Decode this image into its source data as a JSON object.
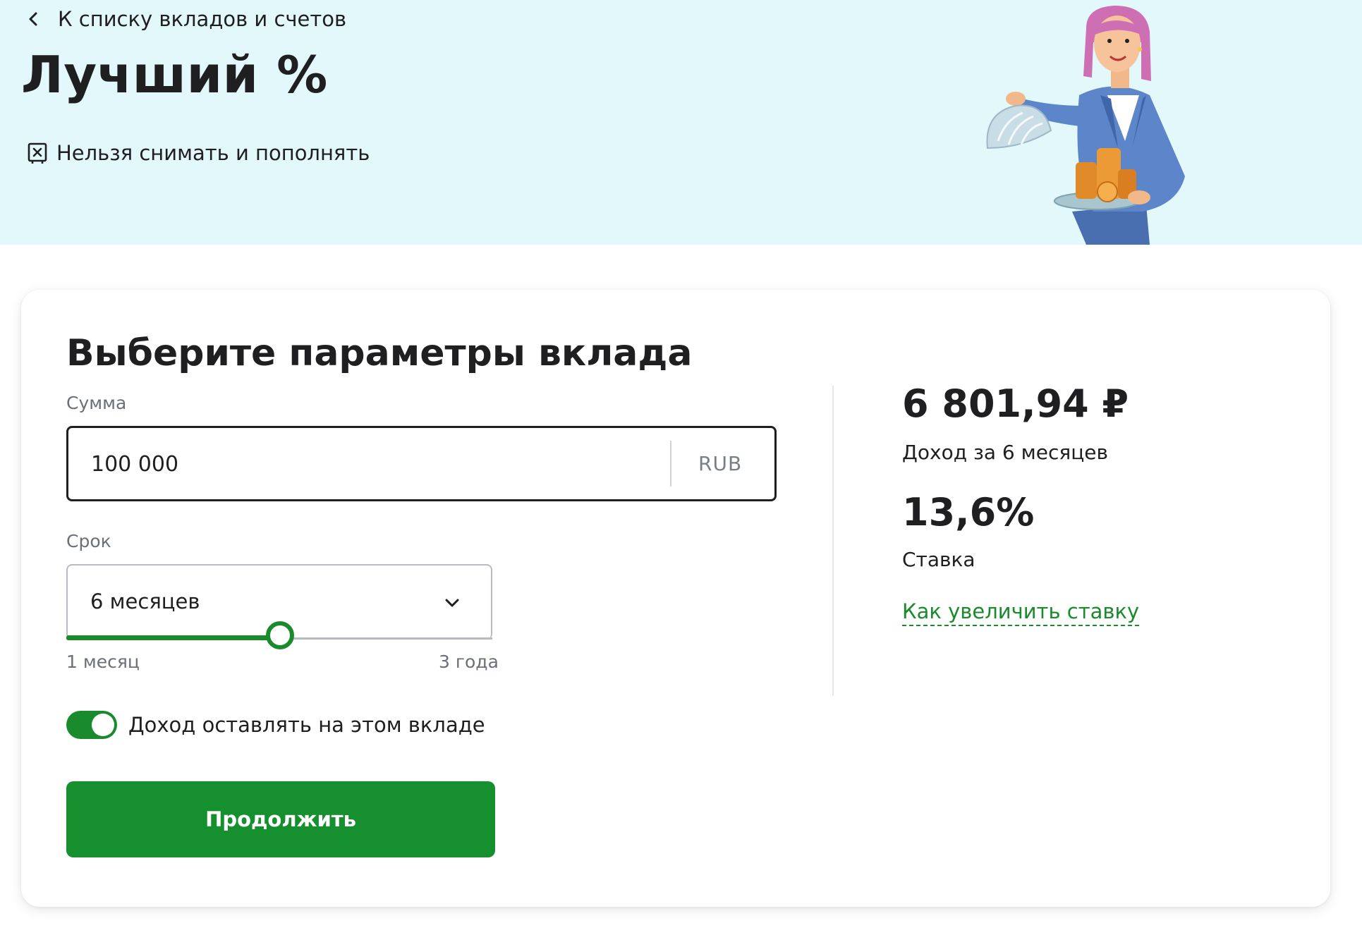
{
  "header": {
    "back_label": "К списку вкладов и счетов",
    "title": "Лучший %",
    "restriction": "Нельзя снимать и пополнять"
  },
  "form": {
    "title": "Выберите параметры вклада",
    "amount_label": "Сумма",
    "amount_value": "100 000",
    "currency": "RUB",
    "term_label": "Срок",
    "term_value": "6 месяцев",
    "term_min_label": "1 месяц",
    "term_max_label": "3 года",
    "term_slider_fraction": 0.5,
    "capitalize_label": "Доход оставлять на этом вкладе",
    "capitalize_on": true,
    "continue_label": "Продолжить"
  },
  "summary": {
    "income_amount": "6 801,94 ₽",
    "income_label": "Доход за 6 месяцев",
    "rate_value": "13,6%",
    "rate_label": "Ставка",
    "rate_link": "Как увеличить ставку"
  },
  "colors": {
    "hero_bg": "#e2f8fb",
    "accent_green": "#1a8b2c",
    "button_green": "#16902e",
    "text_dark": "#1f1f22",
    "text_muted": "#6b6f78"
  },
  "icons": {
    "back": "chevron-left-icon",
    "restriction": "no-withdraw-icon",
    "dropdown": "chevron-down-icon"
  }
}
